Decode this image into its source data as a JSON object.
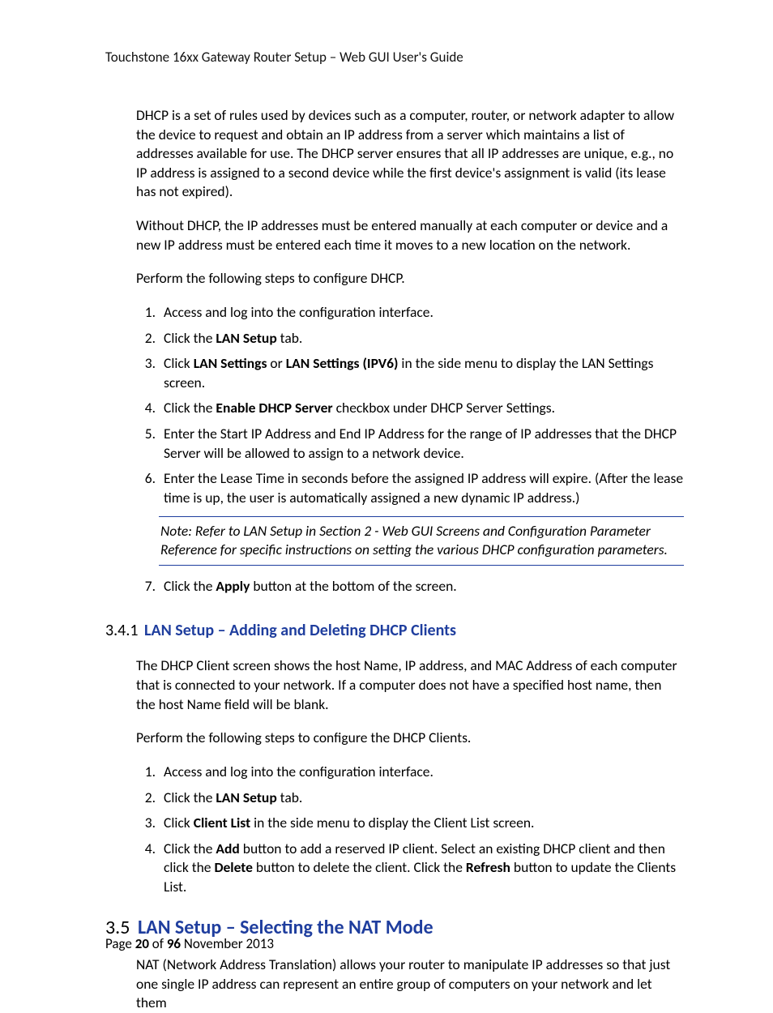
{
  "header": {
    "running": "Touchstone 16xx Gateway Router Setup – Web GUI User's Guide"
  },
  "intro": {
    "p1": "DHCP is a set of rules used by devices such as a computer, router, or network adapter to allow the device to request and obtain an IP address from a server which maintains a list of addresses available for use.  The DHCP server ensures that all IP addresses are unique, e.g., no IP address is assigned to a second device while the first device's assignment is valid (its lease has not expired).",
    "p2": "Without DHCP, the IP addresses must be entered manually at each computer or device and a new IP address must be entered each time it  moves to a new location on the network.",
    "p3": "Perform the following steps to configure DHCP."
  },
  "steps1": {
    "s1": "Access and log into the configuration interface.",
    "s2_a": "Click the ",
    "s2_b": "LAN Setup",
    "s2_c": " tab.",
    "s3_a": "Click ",
    "s3_b": "LAN Settings",
    "s3_c": " or ",
    "s3_d": "LAN Settings (IPV6)",
    "s3_e": " in the side menu to display the LAN Settings screen.",
    "s4_a": "Click the ",
    "s4_b": "Enable DHCP Server",
    "s4_c": " checkbox under DHCP Server Settings.",
    "s5": "Enter the Start IP Address and End IP Address for the range of IP addresses that the DHCP Server will be allowed to assign to a network device.",
    "s6": "Enter the Lease Time in seconds before the assigned IP address will expire.  (After the lease time is up, the user is automatically assigned a new dynamic IP address.)",
    "note": "Note:  Refer to LAN Setup in Section 2 - Web GUI Screens and Configuration Parameter Reference for specific instructions  on setting the various DHCP configuration parameters.",
    "s7_a": "Click the ",
    "s7_b": "Apply",
    "s7_c": " button at the bottom of the screen."
  },
  "sec341": {
    "num": "3.4.1",
    "title": "LAN Setup – Adding and Deleting DHCP Clients",
    "p1": "The DHCP Client screen shows the host Name, IP address, and MAC Address of each computer that is connected to your network.  If a computer does not have a specified host name, then the host Name field will be blank.",
    "p2": "Perform the following steps to configure the DHCP Clients."
  },
  "steps2": {
    "s1": "Access and log into the configuration interface.",
    "s2_a": "Click the ",
    "s2_b": "LAN Setup",
    "s2_c": " tab.",
    "s3_a": "Click ",
    "s3_b": "Client List",
    "s3_c": " in the side menu to display the Client List screen.",
    "s4_a": "Click the ",
    "s4_b": "Add",
    "s4_c": " button to add a reserved IP client.  Select an existing DHCP client and then click the ",
    "s4_d": "Delete",
    "s4_e": " button to delete the client.  Click the ",
    "s4_f": "Refresh",
    "s4_g": " button to update the Clients List."
  },
  "sec35": {
    "num": "3.5",
    "title": "LAN Setup – Selecting the NAT Mode",
    "p1": "NAT (Network Address Translation) allows your router to manipulate IP addresses so that just one single IP address can represent an entire group of computers on your network and let them"
  },
  "footer": {
    "a": "Page ",
    "pg": "20",
    "b": " of ",
    "total": "96",
    "c": "    November 2013"
  }
}
